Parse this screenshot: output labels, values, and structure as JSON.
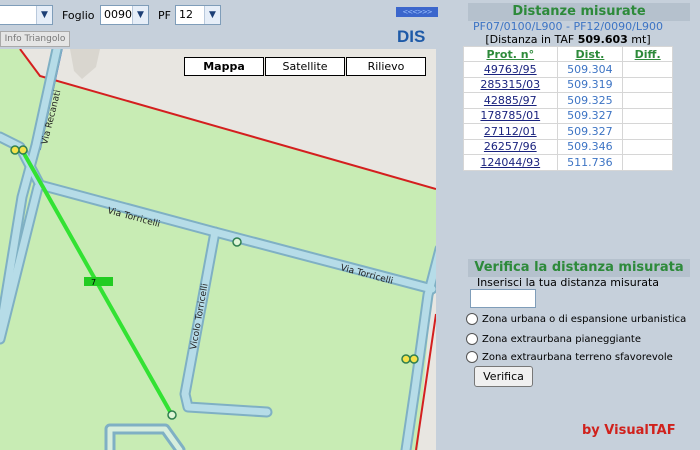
{
  "toolbar": {
    "foglio_label": "Foglio",
    "foglio_value": "0090",
    "pf_label": "PF",
    "pf_value": "12",
    "info_button": "Info Triangolo",
    "nav_arrows": "<<<>>>",
    "logo": "DIS"
  },
  "map": {
    "types": [
      "Mappa",
      "Satellite",
      "Rilievo"
    ],
    "active_type": "Mappa",
    "streets": [
      "Via Recanati",
      "Via Torricelli",
      "Via Torricelli",
      "Vicolo Torricelli"
    ],
    "segment_marker": "7",
    "colors": {
      "land": "#c8ecb4",
      "road": "#a9d1e0",
      "boundary": "#d41f1f",
      "measure_line": "#33e233"
    }
  },
  "distances": {
    "title": "Distanze misurate",
    "subtitle": "PF07/0100/L900 - PF12/0090/L900",
    "taf_prefix": "[Distanza in TAF",
    "taf_value": "509.603",
    "taf_suffix": "mt]",
    "headers": [
      "Prot. n°",
      "Dist.",
      "Diff."
    ],
    "rows": [
      {
        "prot": "49763/95",
        "dist": "509.304",
        "diff": ""
      },
      {
        "prot": "285315/03",
        "dist": "509.319",
        "diff": ""
      },
      {
        "prot": "42885/97",
        "dist": "509.325",
        "diff": ""
      },
      {
        "prot": "178785/01",
        "dist": "509.327",
        "diff": ""
      },
      {
        "prot": "27112/01",
        "dist": "509.327",
        "diff": ""
      },
      {
        "prot": "26257/96",
        "dist": "509.346",
        "diff": ""
      },
      {
        "prot": "124044/93",
        "dist": "511.736",
        "diff": ""
      }
    ]
  },
  "verify": {
    "title": "Verifica la distanza misurata",
    "subtitle": "Inserisci la tua distanza misurata",
    "input_value": "",
    "options": [
      "Zona urbana o di espansione urbanistica",
      "Zona extraurbana pianeggiante",
      "Zona extraurbana terreno sfavorevole"
    ],
    "button": "Verifica"
  },
  "credit": "by VisualTAF"
}
